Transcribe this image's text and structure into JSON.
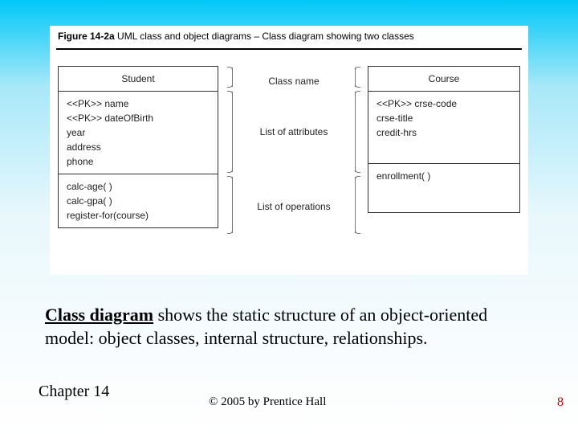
{
  "figure": {
    "label_prefix": "Figure 14-2a",
    "label_rest": "  UML class and object diagrams – Class diagram showing two classes"
  },
  "classes": {
    "student": {
      "name": "Student",
      "attrs": [
        "<<PK>> name",
        "<<PK>> dateOfBirth",
        "year",
        "address",
        "phone"
      ],
      "ops": [
        "calc-age( )",
        "calc-gpa( )",
        "register-for(course)"
      ]
    },
    "course": {
      "name": "Course",
      "attrs": [
        "<<PK>> crse-code",
        "crse-title",
        "credit-hrs"
      ],
      "ops": [
        "enrollment( )"
      ]
    }
  },
  "labels": {
    "class_name": "Class name",
    "list_attributes": "List of attributes",
    "list_operations": "List of operations"
  },
  "definition": {
    "term": "Class diagram",
    "rest": " shows the static structure of an object-oriented model: object classes, internal structure, relationships."
  },
  "footer": {
    "chapter": "Chapter 14",
    "copyright": "© 2005 by Prentice Hall",
    "page": "8"
  }
}
